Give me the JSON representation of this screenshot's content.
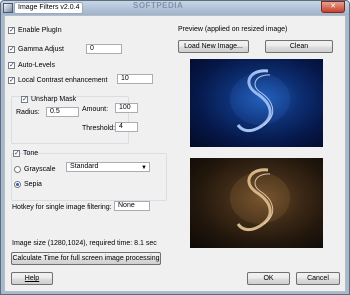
{
  "window": {
    "title": "Image Filters v2.0.4",
    "watermark": "SOFTPEDIA",
    "close_glyph": "✕"
  },
  "options": {
    "enable_plugin": {
      "label": "Enable PlugIn",
      "checked": true
    },
    "gamma_adjust": {
      "label": "Gamma Adjust",
      "checked": true,
      "value": "0"
    },
    "auto_levels": {
      "label": "Auto-Levels",
      "checked": true
    },
    "local_contrast": {
      "label": "Local Contrast enhancement",
      "checked": true,
      "value": "10"
    }
  },
  "unsharp": {
    "label": "Unsharp Mask",
    "checked": true,
    "radius_label": "Radius:",
    "radius_value": "0.5",
    "amount_label": "Amount:",
    "amount_value": "100",
    "threshold_label": "Threshold:",
    "threshold_value": "4"
  },
  "tone": {
    "label": "Tone",
    "checked": true,
    "grayscale_label": "Grayscale",
    "sepia_label": "Sepia",
    "selected": "Sepia",
    "mode_value": "Standard"
  },
  "hotkey": {
    "label": "Hotkey for single image filtering:",
    "value": "None"
  },
  "status": {
    "text": "Image size (1280,1024), required time: 8.1 sec"
  },
  "buttons": {
    "calculate": "Calculate Time for full screen image processing",
    "help": "Help",
    "ok": "OK",
    "cancel": "Cancel",
    "load": "Load New Image...",
    "clean": "Clean"
  },
  "preview": {
    "label": "Preview (applied on resized image)"
  },
  "colors": {
    "window_frame": "#a9b9cc",
    "client_bg": "#f0f0f0",
    "preview_blue": "#0d2f73",
    "preview_sepia": "#3e2a17"
  }
}
